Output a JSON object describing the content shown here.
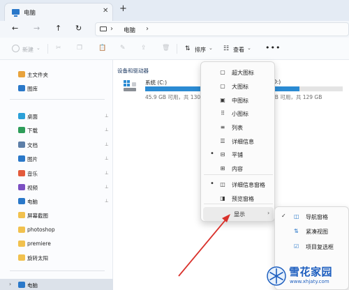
{
  "tab": {
    "title": "电脑",
    "close": "✕",
    "add": "+"
  },
  "nav": {
    "back": "←",
    "forward": "→",
    "up": "↑",
    "refresh": "↻",
    "sep": "›",
    "address": "电脑"
  },
  "toolbar": {
    "new_label": "新建",
    "sort_label": "排序",
    "view_label": "查看",
    "more": "•••"
  },
  "sidebar": {
    "items": [
      {
        "label": "主文件夹",
        "icon": "home-icon",
        "color": "#e8a33d"
      },
      {
        "label": "图库",
        "icon": "gallery-icon",
        "color": "#2a78c9"
      },
      {
        "label": "桌面",
        "icon": "desktop-icon",
        "color": "#2ba0d8",
        "pinned": true
      },
      {
        "label": "下载",
        "icon": "download-icon",
        "color": "#2e9d5a",
        "pinned": true
      },
      {
        "label": "文档",
        "icon": "document-icon",
        "color": "#5d7fa8",
        "pinned": true
      },
      {
        "label": "图片",
        "icon": "picture-icon",
        "color": "#2a78c9",
        "pinned": true
      },
      {
        "label": "音乐",
        "icon": "music-icon",
        "color": "#e35b3c",
        "pinned": true
      },
      {
        "label": "视频",
        "icon": "video-icon",
        "color": "#7b4fc2",
        "pinned": true
      },
      {
        "label": "电脑",
        "icon": "computer-icon",
        "color": "#2a78c9",
        "pinned": true
      },
      {
        "label": "屏幕截图",
        "icon": "folder-icon",
        "color": "#f1c14e"
      },
      {
        "label": "photoshop",
        "icon": "folder-icon",
        "color": "#f1c14e"
      },
      {
        "label": "premiere",
        "icon": "folder-icon",
        "color": "#f1c14e"
      },
      {
        "label": "旋转太阳",
        "icon": "folder-icon",
        "color": "#f1c14e"
      },
      {
        "label": "电脑",
        "icon": "computer-icon",
        "color": "#2a78c9"
      }
    ],
    "pin_glyph": "📌",
    "chevron": "›"
  },
  "content": {
    "group_header": "设备和驱动器",
    "drive_c": {
      "name": "系统 (C:)",
      "info": "45.9 GB 可用，共 130"
    },
    "drive_d": {
      "name": "(D:)",
      "info": "GB 可用，共 129 GB"
    }
  },
  "view_menu": {
    "items": [
      {
        "label": "超大图标",
        "icon": "▢"
      },
      {
        "label": "大图标",
        "icon": "▢"
      },
      {
        "label": "中图标",
        "icon": "▣"
      },
      {
        "label": "小图标",
        "icon": "⠿"
      },
      {
        "label": "列表",
        "icon": "≡"
      },
      {
        "label": "详细信息",
        "icon": "☰"
      },
      {
        "label": "平铺",
        "icon": "⊟",
        "selected": true
      },
      {
        "label": "内容",
        "icon": "⊞"
      },
      {
        "label": "详细信息窗格",
        "icon": "◫",
        "selected": true
      },
      {
        "label": "预览窗格",
        "icon": "◨"
      },
      {
        "label": "显示",
        "icon": "",
        "submenu": true
      }
    ],
    "dot": "•",
    "arrow": "›"
  },
  "show_menu": {
    "items": [
      {
        "label": "导航窗格",
        "icon": "◫",
        "checked": true
      },
      {
        "label": "紧凑视图",
        "icon": "⇅"
      },
      {
        "label": "项目复选框",
        "icon": "☑"
      }
    ],
    "check": "✓"
  },
  "watermark": {
    "main": "雪花家园",
    "sub": "www.xhjaty.com"
  }
}
